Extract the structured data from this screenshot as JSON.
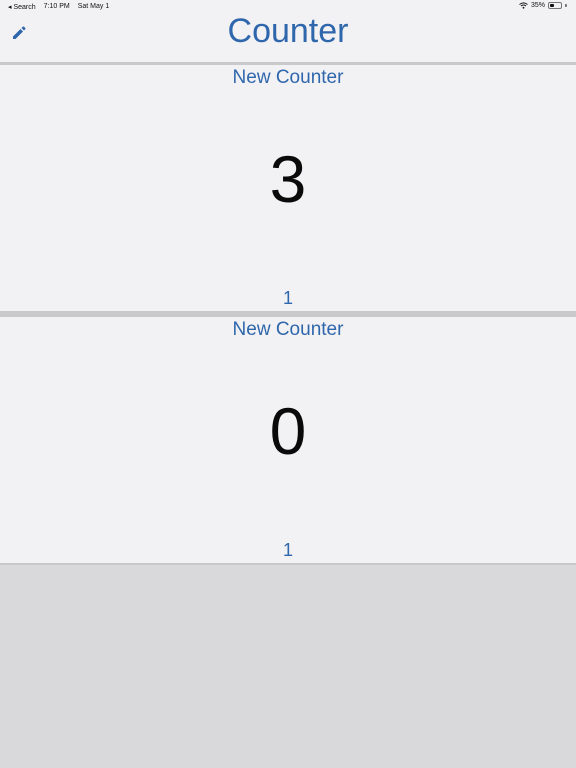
{
  "status_bar": {
    "back_label": "◂ Search",
    "time": "7:10 PM",
    "date": "Sat May 1",
    "battery_percent": "35%",
    "battery_level": 0.35
  },
  "header": {
    "title": "Counter",
    "edit_icon": "pencil-icon"
  },
  "counters": [
    {
      "name": "New Counter",
      "value": "3",
      "step": "1"
    },
    {
      "name": "New Counter",
      "value": "0",
      "step": "1"
    }
  ],
  "colors": {
    "accent": "#2f67ac",
    "card_background": "#f2f1f4",
    "page_background": "#d9d8db"
  }
}
